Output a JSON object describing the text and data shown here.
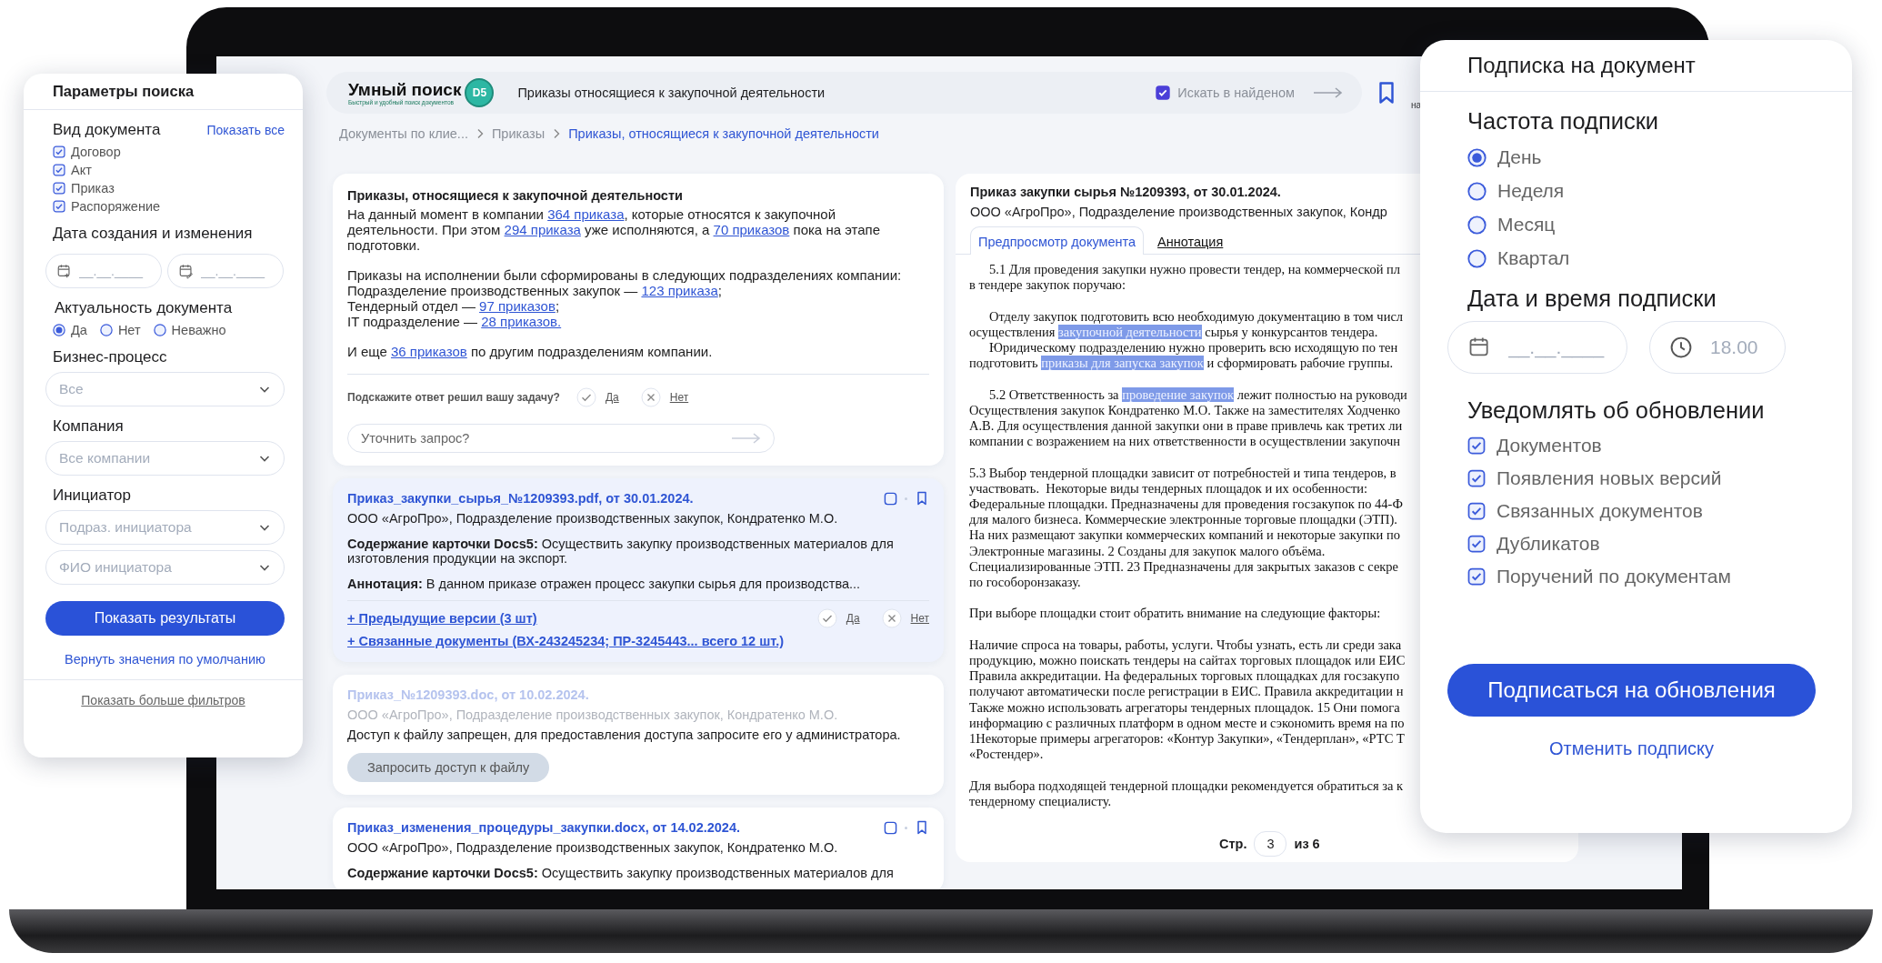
{
  "search_panel": {
    "title": "Параметры поиска",
    "doc_type": {
      "label": "Вид документа",
      "show_all": "Показать все",
      "options": [
        {
          "label": "Договор",
          "checked": true
        },
        {
          "label": "Акт",
          "checked": true
        },
        {
          "label": "Приказ",
          "checked": true
        },
        {
          "label": "Распоряжение",
          "checked": true
        }
      ]
    },
    "dates": {
      "label": "Дата создания и изменения",
      "fields": [
        {
          "kind": "created",
          "placeholder": "__.__.____"
        },
        {
          "kind": "edited",
          "placeholder": "__.__.____"
        }
      ]
    },
    "relevance": {
      "label": "Актуальность документа",
      "options": [
        {
          "label": "Да",
          "selected": true
        },
        {
          "label": "Нет",
          "selected": false
        },
        {
          "label": "Неважно",
          "selected": false
        }
      ]
    },
    "business_process": {
      "label": "Бизнес-процесс",
      "placeholder": "Все"
    },
    "company": {
      "label": "Компания",
      "placeholder": "Все компании"
    },
    "initiator": {
      "label": "Инициатор",
      "fields": [
        {
          "placeholder": "Подраз. инициатора"
        },
        {
          "placeholder": "ФИО инициатора"
        }
      ]
    },
    "submit": "Показать результаты",
    "reset": "Вернуть значения по умолчанию",
    "more": "Показать больше фильтров"
  },
  "topbar": {
    "logo": {
      "name": "Умный поиск",
      "badge": "D5",
      "tagline": "Быстрый и удобный поиск документов"
    },
    "query": "Приказы относящиеся к закупочной деятельности",
    "search_in_found": {
      "label": "Искать в найденом",
      "checked": true
    },
    "bookmark_label": "на"
  },
  "breadcrumbs": [
    {
      "label": "Документы по клие...",
      "selected": false
    },
    {
      "label": "Приказы",
      "selected": false
    },
    {
      "label": "Приказы, относящиеся к закупочной деятельности",
      "selected": true
    }
  ],
  "summary": {
    "title": "Приказы, относящиеся к закупочной деятельности",
    "blocks": [
      [
        [
          {
            "kind": "text",
            "text": "На данный момент в компании "
          },
          {
            "kind": "link",
            "text": "364 приказа"
          },
          {
            "kind": "text",
            "text": ", которые относятся к закупочной деятельности. При этом "
          },
          {
            "kind": "link",
            "text": "294 приказа"
          },
          {
            "kind": "text",
            "text": " уже исполняются, а "
          },
          {
            "kind": "link",
            "text": "70 приказов"
          },
          {
            "kind": "text",
            "text": " пока на этапе подготовки."
          }
        ]
      ],
      [
        [
          {
            "kind": "text",
            "text": "Приказы на исполнении были сформированы в следующих подразделениях компании:"
          }
        ],
        [
          {
            "kind": "text",
            "text": "Подразделение производственных закупок — "
          },
          {
            "kind": "link",
            "text": "123 приказа"
          },
          {
            "kind": "text",
            "text": ";"
          }
        ],
        [
          {
            "kind": "text",
            "text": "Тендерный отдел — "
          },
          {
            "kind": "link",
            "text": "97 приказов"
          },
          {
            "kind": "text",
            "text": ";"
          }
        ],
        [
          {
            "kind": "text",
            "text": "IT подразделение — "
          },
          {
            "kind": "link",
            "text": "28 приказов."
          }
        ]
      ],
      [
        [
          {
            "kind": "text",
            "text": "И еще "
          },
          {
            "kind": "link",
            "text": "36 приказов"
          },
          {
            "kind": "text",
            "text": " по другим подразделениям компании."
          }
        ]
      ]
    ],
    "feedback": {
      "question": "Подскажите ответ решил вашу задачу?",
      "yes": "Да",
      "no": "Нет"
    },
    "refine": {
      "placeholder": "Уточнить запрос?"
    }
  },
  "results": [
    {
      "kind": "full",
      "selected": true,
      "title": "Приказ_закупки_сырья_№1209393.pdf,  от 30.01.2024.",
      "meta": "ООО «АгроПро»,  Подразделение производственных закупок,  Кондратенко М.О.",
      "content": "**Содержание карточки Docs5:** Осуществить закупку производственных материалов для изготовления продукции на экспорт.",
      "annotation": "**Аннотация:** В данном приказе отражен процесс закупки сырья для производства...",
      "versions": "+ Предыдущие версии (3 шт)",
      "related": "+ Связанные документы (ВХ-243245234; ПР-3245443... всего 12 шт.)",
      "feedback": {
        "yes": "Да",
        "no": "Нет"
      }
    },
    {
      "kind": "restricted",
      "selected": false,
      "title": "Приказ_№1209393.doc,  от 10.02.2024.",
      "meta": "ООО «АгроПро»,  Подразделение производственных закупок,  Кондратенко М.О.",
      "notice": "Доступ к файлу запрещен, для предоставления доступа запросите его у администратора.",
      "request": "Запросить доступ к файлу"
    },
    {
      "kind": "full",
      "selected": false,
      "title": "Приказ_изменения_процедуры_закупки.docx,  от 14.02.2024.",
      "meta": "ООО «АгроПро»,  Подразделение производственных закупок,  Кондратенко М.О.",
      "content": "**Содержание карточки Docs5:** Осуществить закупку производственных материалов для"
    }
  ],
  "viewer": {
    "title": "Приказ закупки сырья №1209393,  от 30.01.2024.",
    "meta": "ООО «АгроПро»,  Подразделение производственных закупок,  Кондр",
    "tabs": [
      {
        "label": "Предпросмотр документа",
        "selected": true
      },
      {
        "label": "Аннотация",
        "selected": false
      }
    ],
    "paragraphs": [
      {
        "lines": [
          {
            "kind": "indent",
            "parts": [
              {
                "text": "5.1 Для проведения закупки нужно провести тендер, на коммерческой пл",
                "highlighted": false
              }
            ]
          },
          {
            "kind": "plain",
            "parts": [
              {
                "text": "в тендере закупок поручаю:",
                "highlighted": false
              }
            ]
          }
        ]
      },
      {
        "lines": [
          {
            "kind": "indent",
            "parts": [
              {
                "text": "Отделу закупок подготовить всю необходимую документацию в том числ",
                "highlighted": false
              }
            ]
          },
          {
            "kind": "plain",
            "parts": [
              {
                "text": "осуществления ",
                "highlighted": false
              },
              {
                "text": "закупочной деятельности",
                "highlighted": true
              },
              {
                "text": " сырья у конкурсантов тендера.",
                "highlighted": false
              }
            ]
          },
          {
            "kind": "indent",
            "parts": [
              {
                "text": "Юридическому подразделению нужно проверить всю исходящую по тен",
                "highlighted": false
              }
            ]
          },
          {
            "kind": "plain",
            "parts": [
              {
                "text": "подготовить ",
                "highlighted": false
              },
              {
                "text": "приказы для запуска закупок",
                "highlighted": true
              },
              {
                "text": " и сформировать рабочие группы.",
                "highlighted": false
              }
            ]
          }
        ]
      },
      {
        "lines": [
          {
            "kind": "indent",
            "parts": [
              {
                "text": "5.2 Ответственность за ",
                "highlighted": false
              },
              {
                "text": "проведение закупок",
                "highlighted": true
              },
              {
                "text": " лежит полностью на руководи",
                "highlighted": false
              }
            ]
          },
          {
            "kind": "plain",
            "parts": [
              {
                "text": "Осуществления закупок Кондратенко М.О. Также на заместителях Ходченко",
                "highlighted": false
              }
            ]
          },
          {
            "kind": "plain",
            "parts": [
              {
                "text": "А.В. Для осуществления данной закупки они в праве привлечь как третих ли",
                "highlighted": false
              }
            ]
          },
          {
            "kind": "plain",
            "parts": [
              {
                "text": "компании с возражением на них ответственности в осуществлении закупочн",
                "highlighted": false
              }
            ]
          }
        ]
      },
      {
        "lines": [
          {
            "kind": "plain",
            "parts": [
              {
                "text": "5.3 Выбор тендерной площадки зависит от потребностей и типа тендеров, в",
                "highlighted": false
              }
            ]
          },
          {
            "kind": "plain",
            "parts": [
              {
                "text": "участвовать.  Некоторые виды тендерных площадок и их особенности:",
                "highlighted": false
              }
            ]
          },
          {
            "kind": "plain",
            "parts": [
              {
                "text": "Федеральные площадки. Предназначены для проведения госзакупок по 44-Ф",
                "highlighted": false
              }
            ]
          },
          {
            "kind": "plain",
            "parts": [
              {
                "text": "для малого бизнеса. Коммерческие электронные торговые площадки (ЭТП).",
                "highlighted": false
              }
            ]
          },
          {
            "kind": "plain",
            "parts": [
              {
                "text": "На них размещают закупки коммерческих компаний и некоторые закупки по",
                "highlighted": false
              }
            ]
          },
          {
            "kind": "plain",
            "parts": [
              {
                "text": "Электронные магазины. 2 Созданы для закупок малого объёма.",
                "highlighted": false
              }
            ]
          },
          {
            "kind": "plain",
            "parts": [
              {
                "text": "Специализированные ЭТП. 23 Предназначены для закрытых заказов с секре",
                "highlighted": false
              }
            ]
          },
          {
            "kind": "plain",
            "parts": [
              {
                "text": "по гособоронзаказу.",
                "highlighted": false
              }
            ]
          }
        ]
      },
      {
        "lines": [
          {
            "kind": "plain",
            "parts": [
              {
                "text": "При выборе площадки стоит обратить внимание на следующие факторы:",
                "highlighted": false
              }
            ]
          }
        ]
      },
      {
        "lines": [
          {
            "kind": "plain",
            "parts": [
              {
                "text": "Наличие спроса на товары, работы, услуги. Чтобы узнать, есть ли среди зака",
                "highlighted": false
              }
            ]
          },
          {
            "kind": "plain",
            "parts": [
              {
                "text": "продукцию, можно поискать тендеры на сайтах торговых площадок или ЕИС",
                "highlighted": false
              }
            ]
          },
          {
            "kind": "plain",
            "parts": [
              {
                "text": "Правила аккредитации. На федеральных торговых площадках для госзакупо",
                "highlighted": false
              }
            ]
          },
          {
            "kind": "plain",
            "parts": [
              {
                "text": "получают автоматически после регистрации в ЕИС. Правила аккредитации н",
                "highlighted": false
              }
            ]
          },
          {
            "kind": "plain",
            "parts": [
              {
                "text": "Также можно использовать агрегаторы тендерных площадок. 15 Они помога",
                "highlighted": false
              }
            ]
          },
          {
            "kind": "plain",
            "parts": [
              {
                "text": "информацию с различных платформ в одном месте и сэкономить время на по",
                "highlighted": false
              }
            ]
          },
          {
            "kind": "plain",
            "parts": [
              {
                "text": "1Некоторые примеры агрегаторов: «Контур Закупки», «Тендерплан», «РТС Т",
                "highlighted": false
              }
            ]
          },
          {
            "kind": "plain",
            "parts": [
              {
                "text": "«Ростендер».",
                "highlighted": false
              }
            ]
          }
        ]
      },
      {
        "lines": [
          {
            "kind": "plain",
            "parts": [
              {
                "text": "Для выбора подходящей тендерной площадки рекомендуется обратиться за к",
                "highlighted": false
              }
            ]
          },
          {
            "kind": "plain",
            "parts": [
              {
                "text": "тендерному специалисту.",
                "highlighted": false
              }
            ]
          }
        ]
      }
    ],
    "pager": {
      "label": "Стр.",
      "page": "3",
      "total": "из 6"
    }
  },
  "subscription": {
    "title": "Подписка на документ",
    "frequency": {
      "label": "Частота подписки",
      "options": [
        {
          "label": "День",
          "selected": true
        },
        {
          "label": "Неделя",
          "selected": false
        },
        {
          "label": "Месяц",
          "selected": false
        },
        {
          "label": "Квартал",
          "selected": false
        }
      ]
    },
    "datetime": {
      "label": "Дата и время подписки",
      "date": {
        "placeholder": "__.__.____"
      },
      "time": {
        "placeholder": "18.00"
      }
    },
    "notify": {
      "label": "Уведомлять об обновлении",
      "options": [
        {
          "label": "Документов",
          "checked": true
        },
        {
          "label": "Появления новых версий",
          "checked": true
        },
        {
          "label": "Связанных документов",
          "checked": true
        },
        {
          "label": "Дубликатов",
          "checked": true
        },
        {
          "label": "Поручений по документам",
          "checked": true
        }
      ]
    },
    "submit": "Подписаться на обновления",
    "cancel": "Отменить подписку"
  }
}
